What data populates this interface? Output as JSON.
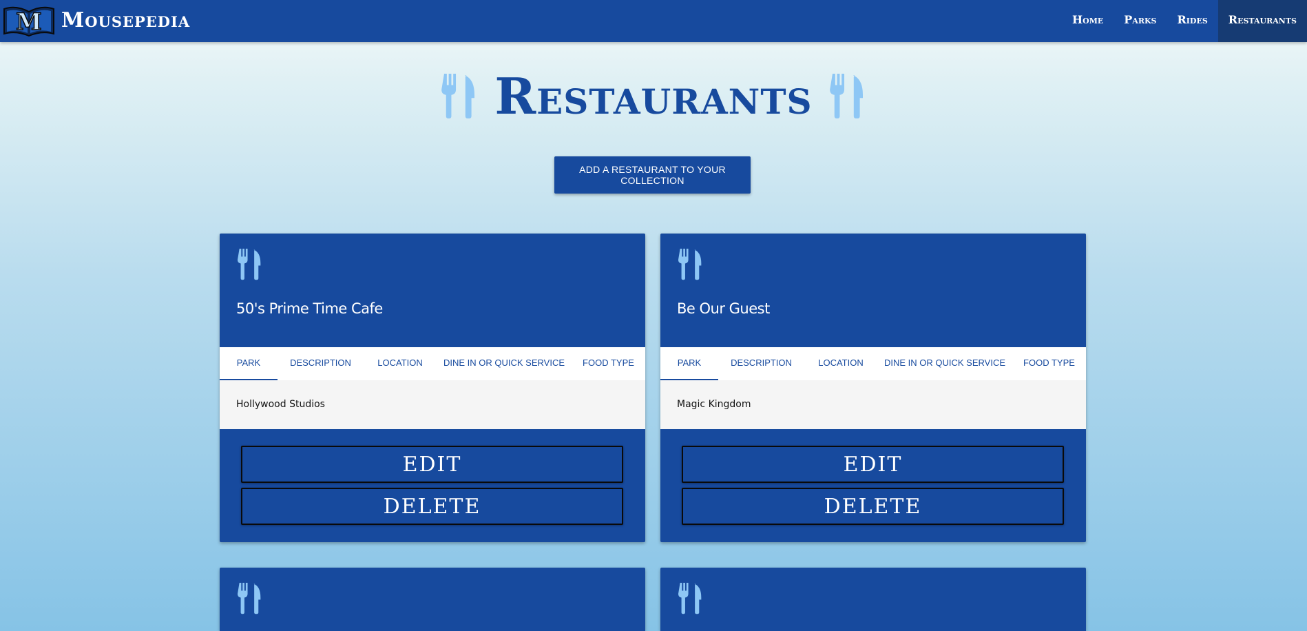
{
  "navbar": {
    "brand": "Mousepedia",
    "links": [
      {
        "label": "Home"
      },
      {
        "label": "Parks"
      },
      {
        "label": "Rides"
      },
      {
        "label": "Restaurants",
        "active": true
      }
    ]
  },
  "page": {
    "title": "Restaurants",
    "add_button": "ADD A RESTAURANT TO YOUR COLLECTION"
  },
  "tabs": [
    "PARK",
    "DESCRIPTION",
    "LOCATION",
    "DINE IN OR QUICK SERVICE",
    "FOOD TYPE"
  ],
  "cards": [
    {
      "name": "50's Prime Time Cafe",
      "active_tab": "PARK",
      "tab_value": "Hollywood Studios",
      "edit_label": "EDIT",
      "delete_label": "DELETE"
    },
    {
      "name": "Be Our Guest",
      "active_tab": "PARK",
      "tab_value": "Magic Kingdom",
      "edit_label": "EDIT",
      "delete_label": "DELETE"
    },
    {
      "name": "",
      "tab_value": ""
    },
    {
      "name": "",
      "tab_value": ""
    }
  ],
  "colors": {
    "primary": "#174a9e",
    "nav_active": "#163b73",
    "icon_light": "#8ec7f5",
    "tab_panel": "#f5f5f5"
  },
  "icons": {
    "brand": "book-m-logo-icon",
    "restaurant": "fork-knife-icon"
  }
}
